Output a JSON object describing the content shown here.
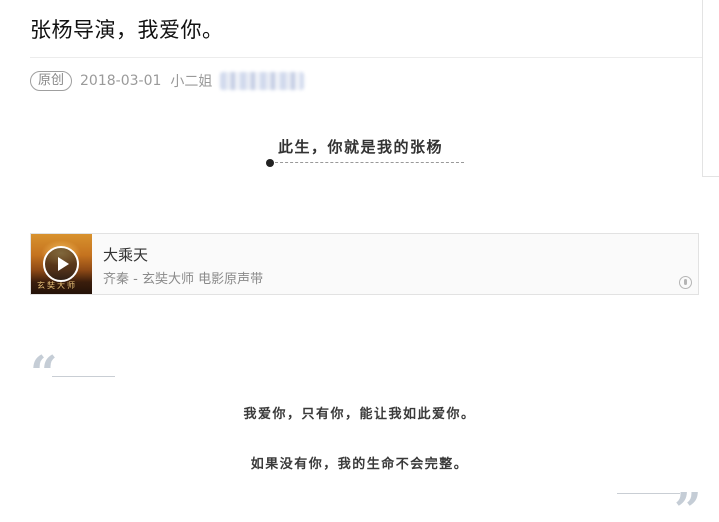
{
  "article": {
    "title": "张杨导演，我爱你。",
    "meta": {
      "badge": "原创",
      "date": "2018-03-01",
      "author": "小二姐"
    }
  },
  "section": {
    "heading": "此生，你就是我的张杨"
  },
  "music_card": {
    "title": "大乘天",
    "subtitle": "齐秦 - 玄奘大师 电影原声带",
    "cover_text": "玄奘大师",
    "play_icon": "play-icon",
    "logo_icon": "music-service-logo-icon"
  },
  "quote": {
    "lines": [
      "我爱你，只有你，能让我如此爱你。",
      "如果没有你，我的生命不会完整。"
    ],
    "open_mark": "“",
    "close_mark": "”"
  },
  "colors": {
    "quote_mark": "#c5cdd6",
    "muted_text": "#9a9a9a",
    "card_background": "#fafafa"
  }
}
